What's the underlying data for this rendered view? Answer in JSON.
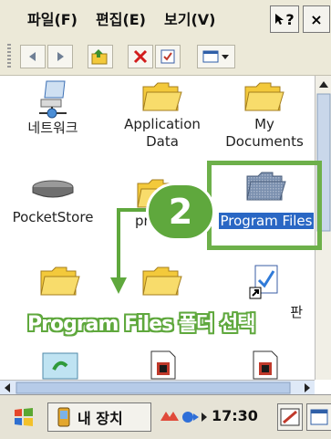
{
  "menu": {
    "file": "파일(F)",
    "edit": "편집(E)",
    "view": "보기(V)",
    "help": "?",
    "close": "×"
  },
  "items": {
    "network": "네트워크",
    "appdata_line1": "Application",
    "appdata_line2": "Data",
    "mydocs_line1": "My",
    "mydocs_line2": "Documents",
    "pocketstore": "PocketStore",
    "pro_partial": "pro",
    "programfiles": "Program Files",
    "shortcut_partial": "판"
  },
  "annotation": {
    "step": "2",
    "callout": "Program Files 폴더 선택"
  },
  "taskbar": {
    "device": "내 장치",
    "time": "17:30"
  },
  "colors": {
    "accent_green": "#5fa83d",
    "selection_blue": "#2a67c4",
    "folder_yellow": "#f3c93b"
  }
}
